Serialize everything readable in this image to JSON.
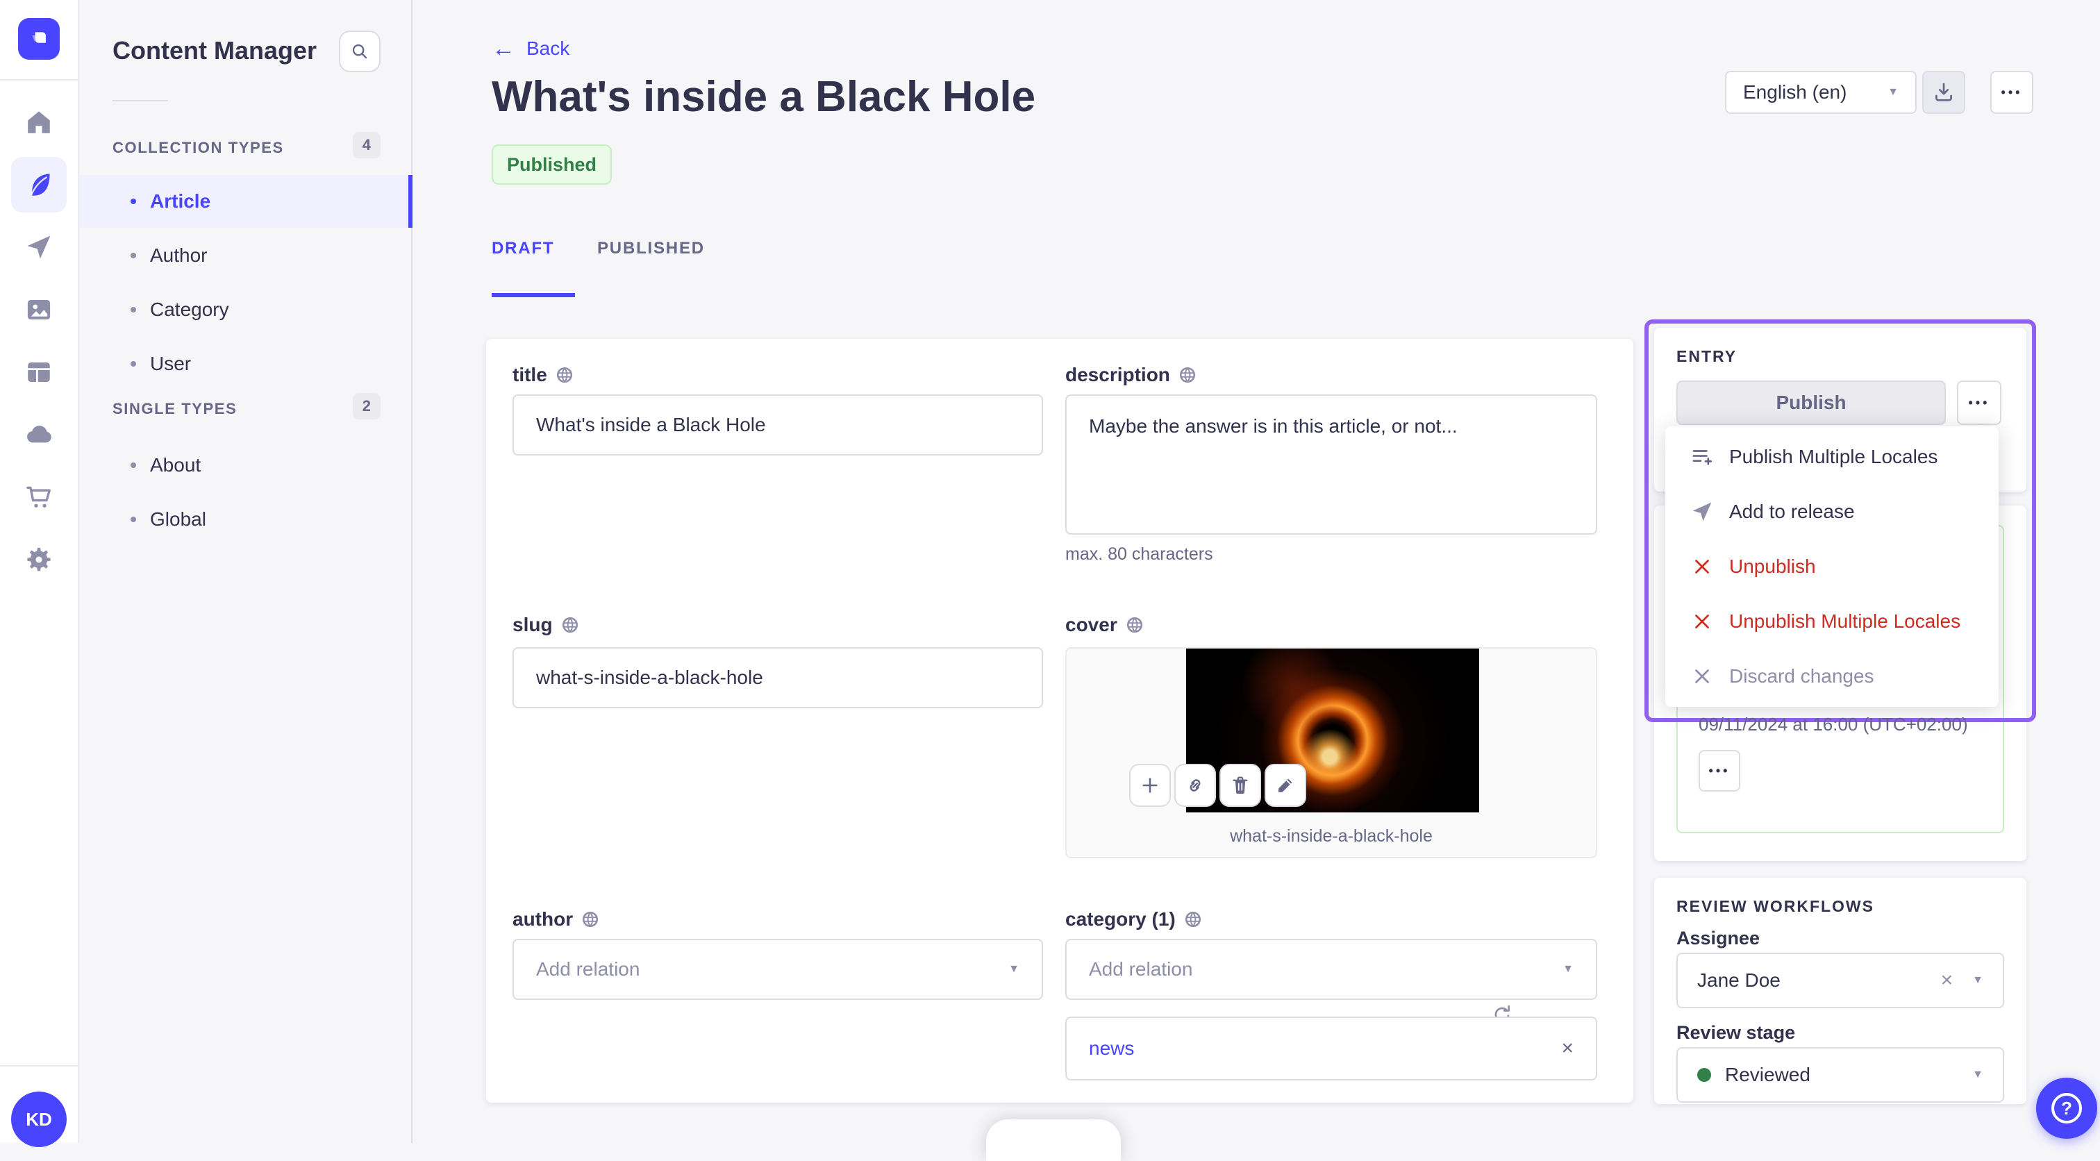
{
  "colors": {
    "primary": "#4945ff",
    "highlight": "#9061f1",
    "danger": "#d02b20",
    "success_text": "#328048",
    "success_bg": "#eafbe7",
    "success_border": "#c6f0c2",
    "text_dark": "#32324d",
    "text_mid": "#666687",
    "text_soft": "#8e8ea9",
    "border": "#dcdce4",
    "border_light": "#eaeaef",
    "bg_app": "#f6f6f9"
  },
  "icons": {
    "back_glyph": "←",
    "chevron_glyph": "▼",
    "close_glyph": "×",
    "more_glyph": "•••",
    "help_glyph": "?"
  },
  "rail": {
    "icons": [
      "home-icon",
      "feather-icon",
      "send-icon",
      "media-icon",
      "layout-icon",
      "cloud-icon",
      "cart-icon",
      "gear-icon"
    ],
    "avatar_initials": "KD"
  },
  "sidebar": {
    "title": "Content Manager",
    "sections": [
      {
        "label": "COLLECTION TYPES",
        "count": "4",
        "items": [
          {
            "label": "Article"
          },
          {
            "label": "Author"
          },
          {
            "label": "Category"
          },
          {
            "label": "User"
          }
        ]
      },
      {
        "label": "SINGLE TYPES",
        "count": "2",
        "items": [
          {
            "label": "About"
          },
          {
            "label": "Global"
          }
        ]
      }
    ]
  },
  "header": {
    "back_label": "Back",
    "title": "What's inside a Black Hole",
    "status": "Published",
    "tabs": [
      "DRAFT",
      "PUBLISHED"
    ],
    "locale": "English (en)"
  },
  "form": {
    "title_field": {
      "label": "title",
      "value": "What's inside a Black Hole"
    },
    "description_field": {
      "label": "description",
      "value": "Maybe the answer is in this article, or not...",
      "hint": "max. 80 characters"
    },
    "slug_field": {
      "label": "slug",
      "value": "what-s-inside-a-black-hole"
    },
    "cover_field": {
      "label": "cover",
      "caption": "what-s-inside-a-black-hole"
    },
    "author_field": {
      "label": "author",
      "placeholder": "Add relation"
    },
    "category_field": {
      "label": "category (1)",
      "placeholder": "Add relation",
      "tag": "news"
    }
  },
  "entry_panel": {
    "heading": "ENTRY",
    "publish_label": "Publish",
    "menu": [
      {
        "label": "Publish Multiple Locales"
      },
      {
        "label": "Add to release"
      },
      {
        "label": "Unpublish"
      },
      {
        "label": "Unpublish Multiple Locales"
      },
      {
        "label": "Discard changes"
      }
    ],
    "release_date": "09/11/2024 at 16:00 (UTC+02:00)"
  },
  "review": {
    "heading": "REVIEW WORKFLOWS",
    "assignee_label": "Assignee",
    "assignee_value": "Jane Doe",
    "stage_label": "Review stage",
    "stage_value": "Reviewed"
  }
}
